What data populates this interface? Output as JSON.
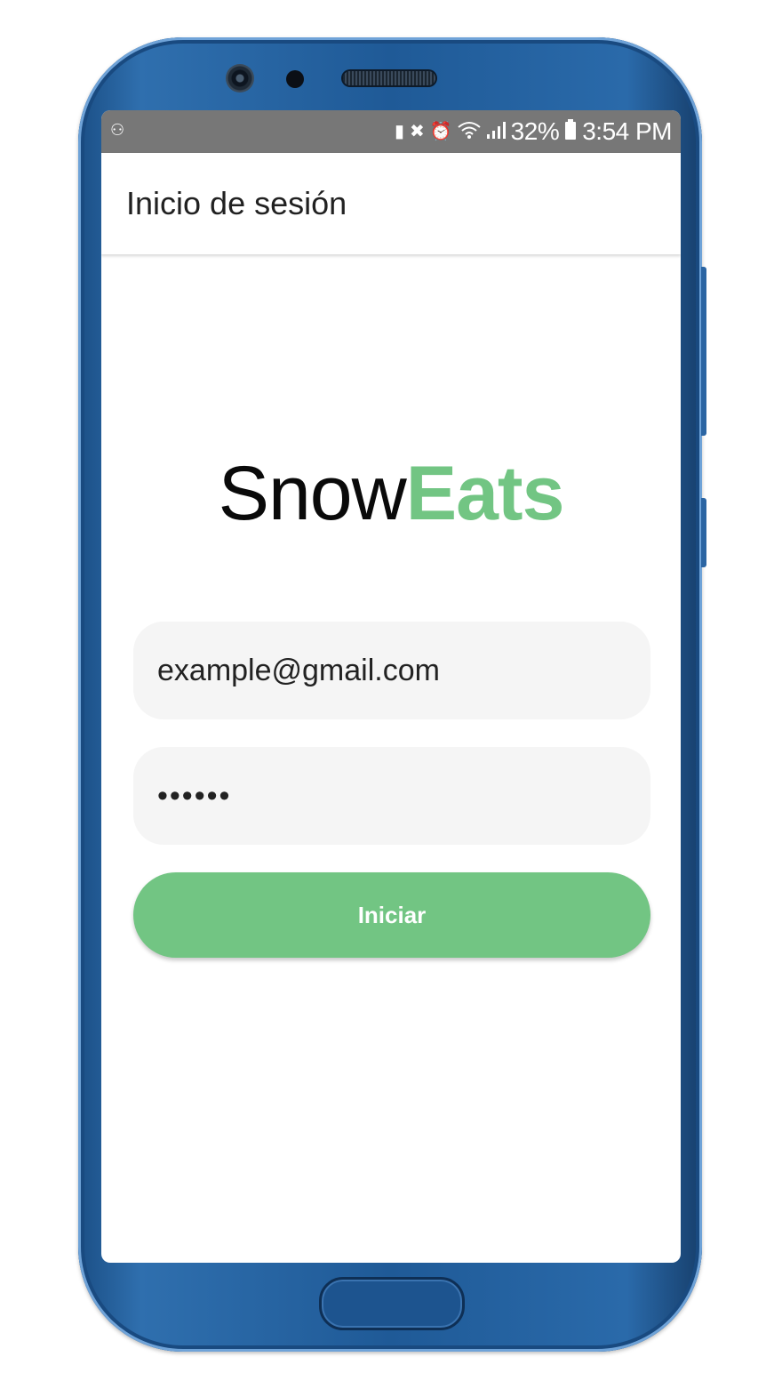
{
  "status_bar": {
    "battery_percent": "32%",
    "time": "3:54 PM",
    "icons": [
      "voicemail-icon",
      "battery-saver-icon",
      "mute-icon",
      "alarm-icon",
      "wifi-icon",
      "signal-icon",
      "battery-icon"
    ]
  },
  "app_bar": {
    "title": "Inicio de sesión"
  },
  "logo": {
    "part1": "Snow",
    "part2": "Eats",
    "part1_color": "#0a0a0a",
    "part2_color": "#72c583"
  },
  "form": {
    "email_value": "example@gmail.com",
    "password_value": "••••••",
    "submit_label": "Iniciar"
  },
  "colors": {
    "accent": "#72c583",
    "status_bar": "#777777",
    "phone_body": "#2a65a3"
  }
}
